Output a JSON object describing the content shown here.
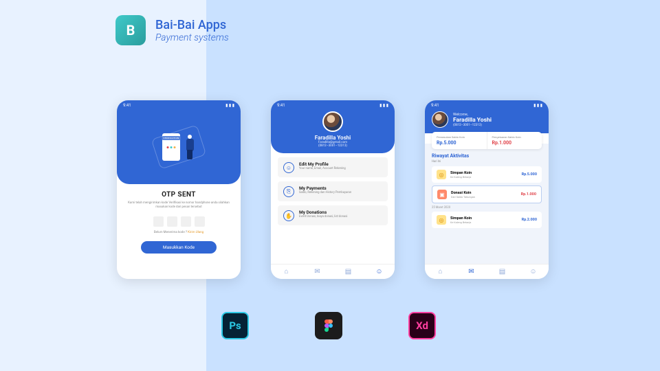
{
  "header": {
    "app_name": "Bai-Bai Apps",
    "subtitle": "Payment systems",
    "logo_letter": "B"
  },
  "statusbar": {
    "time": "9:41"
  },
  "phone1": {
    "hero_tag": "VERIFICATION",
    "title": "OTP SENT",
    "desc": "Kami telah mengirimkan kode Verifikasi ke nomor handphone anda silahkan masukan kode dari pesan tersebut",
    "resend_label": "Belum Menerima kode ?",
    "resend_link": "Kirim Ulang",
    "button": "Masukkan Kode"
  },
  "phone2": {
    "name": "Faradilla Yoshi",
    "email": "Faradilla@gmail.com",
    "phone": "(0812–3001–12313)",
    "items": [
      {
        "icon": "☺",
        "title": "Edit My Profile",
        "sub": "Your name, Email, Account Rekening"
      },
      {
        "icon": "⎘",
        "title": "My Payments",
        "sub": "Saldo, Rekening dan History Pembayaran"
      },
      {
        "icon": "✋",
        "title": "My Donations",
        "sub": "Event Donasi, biaya donasi, list donasi"
      }
    ]
  },
  "phone3": {
    "welcome": "Welcome,",
    "name": "Faradilla Yoshi",
    "phone": "(0812–3001–12313)",
    "balance": {
      "in_label": "Pemasukan Saldo Koin",
      "in_value": "Rp.5.000",
      "out_label": "Pengeluaran Saldo Koin",
      "out_value": "Rp.1.000"
    },
    "section_title": "Riwayat Aktivitas",
    "section_sub": "Hari Ini",
    "activities_today": [
      {
        "icon_class": "y",
        "title": "Simpan Koin",
        "sub": "Ke Kaleng Belanja",
        "amt": "Rp.5.000",
        "amt_class": "blue"
      },
      {
        "icon_class": "r",
        "title": "Donasi Koin",
        "sub": "Dari Saldo Tabungan",
        "amt": "Rp.1.000",
        "amt_class": "red"
      }
    ],
    "date_label": "25 Maret 2020",
    "activities_past": [
      {
        "icon_class": "y",
        "title": "Simpan Koin",
        "sub": "Ke Kaleng Belanja",
        "amt": "Rp.2.000",
        "amt_class": "blue"
      }
    ]
  },
  "tools": {
    "ps": "Ps",
    "xd": "Xd"
  }
}
